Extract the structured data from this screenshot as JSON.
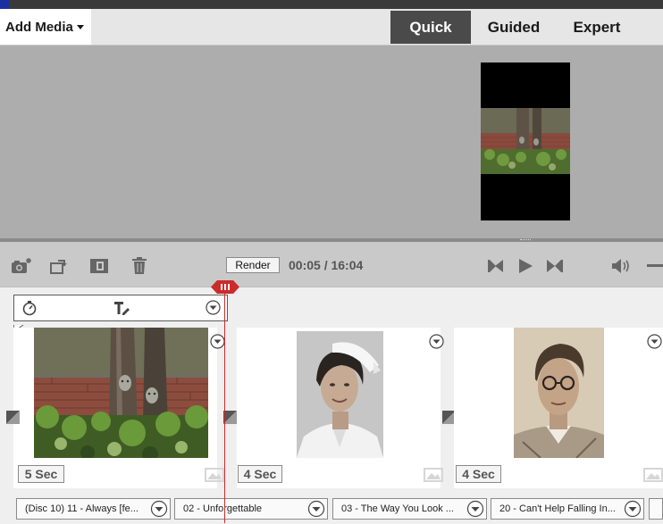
{
  "header": {
    "add_media_label": "Add Media",
    "tabs": [
      {
        "label": "Quick",
        "active": true
      },
      {
        "label": "Guided",
        "active": false
      },
      {
        "label": "Expert",
        "active": false
      }
    ]
  },
  "controls": {
    "render_label": "Render",
    "timecode": "00:05 / 16:04",
    "icons": [
      "camera-icon",
      "rotate-icon",
      "fit-frame-icon",
      "trash-icon",
      "go-to-start-icon",
      "play-icon",
      "go-to-end-icon",
      "volume-icon"
    ]
  },
  "timeline": {
    "clips": [
      {
        "duration": "5 Sec",
        "subject": "tree with garden faces by brick wall"
      },
      {
        "duration": "4 Sec",
        "subject": "nurse portrait photo"
      },
      {
        "duration": "4 Sec",
        "subject": "young man with glasses portrait photo"
      }
    ],
    "audio": [
      "(Disc 10) 11 - Always [fe...",
      "02 - Unforgettable",
      "03 - The Way You Look ...",
      "20 - Can't Help Falling In..."
    ]
  },
  "colors": {
    "active_tab": "#4a4a4a",
    "monitor_bg": "#adadad",
    "playhead": "#cc2b2b",
    "timeline_bg": "#efefef"
  }
}
